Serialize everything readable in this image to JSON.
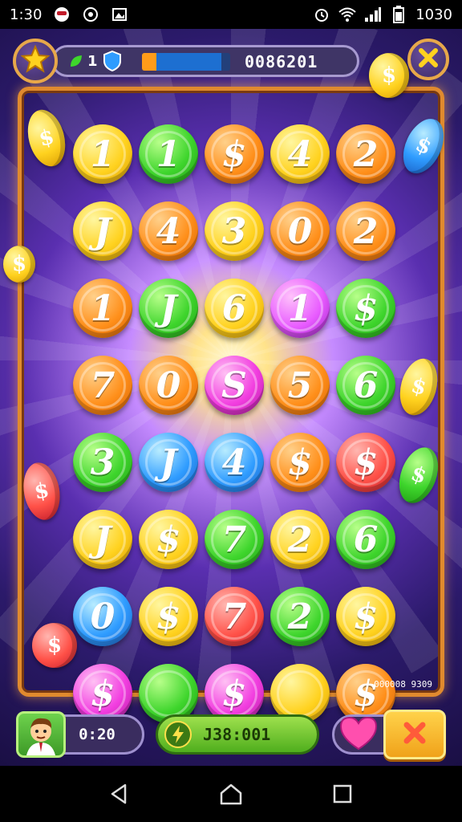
{
  "status_bar": {
    "time": "1:30",
    "clock_right": "1030",
    "icons_left": [
      "game-face-icon",
      "at-icon",
      "image-icon"
    ],
    "icons_right": [
      "alarm-icon",
      "wifi-icon",
      "signal-icon",
      "battery-icon"
    ]
  },
  "hud_top": {
    "level_count": "1",
    "score": "0086201",
    "progress": 0.18,
    "star_icon": "star-icon",
    "close_icon": "close-icon",
    "leaf_icon": "leaf-icon",
    "shield_icon": "shield-icon"
  },
  "board": {
    "code": "000008 9309",
    "rows": [
      [
        {
          "label": "1",
          "color": "yellow"
        },
        {
          "label": "1",
          "color": "green"
        },
        {
          "label": "$",
          "color": "orange"
        },
        {
          "label": "4",
          "color": "yellow"
        },
        {
          "label": "2",
          "color": "orange"
        }
      ],
      [
        {
          "label": "J",
          "color": "yellow"
        },
        {
          "label": "4",
          "color": "orange"
        },
        {
          "label": "3",
          "color": "yellow"
        },
        {
          "label": "0",
          "color": "orange"
        },
        {
          "label": "2",
          "color": "orange"
        }
      ],
      [
        {
          "label": "1",
          "color": "orange"
        },
        {
          "label": "J",
          "color": "green"
        },
        {
          "label": "6",
          "color": "yellow"
        },
        {
          "label": "1",
          "color": "magenta"
        },
        {
          "label": "$",
          "color": "green"
        }
      ],
      [
        {
          "label": "7",
          "color": "orange"
        },
        {
          "label": "0",
          "color": "orange"
        },
        {
          "label": "S",
          "color": "pink"
        },
        {
          "label": "5",
          "color": "orange"
        },
        {
          "label": "6",
          "color": "green"
        }
      ],
      [
        {
          "label": "3",
          "color": "green"
        },
        {
          "label": "J",
          "color": "blue"
        },
        {
          "label": "4",
          "color": "blue"
        },
        {
          "label": "$",
          "color": "orange"
        },
        {
          "label": "$",
          "color": "red"
        }
      ],
      [
        {
          "label": "J",
          "color": "yellow"
        },
        {
          "label": "$",
          "color": "yellow"
        },
        {
          "label": "7",
          "color": "green"
        },
        {
          "label": "2",
          "color": "yellow"
        },
        {
          "label": "6",
          "color": "green"
        }
      ],
      [
        {
          "label": "0",
          "color": "blue"
        },
        {
          "label": "$",
          "color": "yellow"
        },
        {
          "label": "7",
          "color": "red"
        },
        {
          "label": "2",
          "color": "green"
        },
        {
          "label": "$",
          "color": "yellow"
        }
      ],
      [
        {
          "label": "$",
          "color": "pink"
        },
        {
          "label": "",
          "color": "green"
        },
        {
          "label": "$",
          "color": "pink"
        },
        {
          "label": "",
          "color": "yellow"
        },
        {
          "label": "$",
          "color": "orange"
        }
      ]
    ]
  },
  "hud_bottom": {
    "timer": "0:20",
    "coins": "J38:001",
    "avatar_icon": "player-avatar-icon",
    "bolt_icon": "lightning-icon",
    "heart_icon": "heart-icon",
    "x_icon": "close-icon"
  },
  "nav_bar": {
    "back_icon": "back-triangle-icon",
    "home_icon": "home-icon",
    "recents_icon": "recents-square-icon"
  },
  "colors": {
    "yellow": "#ffd21f",
    "orange": "#ff8f1a",
    "green": "#3ed52c",
    "pink": "#f23ee0",
    "blue": "#2f9cff",
    "red": "#ff5148",
    "magenta": "#e85bff",
    "frame": "#e08a2e"
  }
}
